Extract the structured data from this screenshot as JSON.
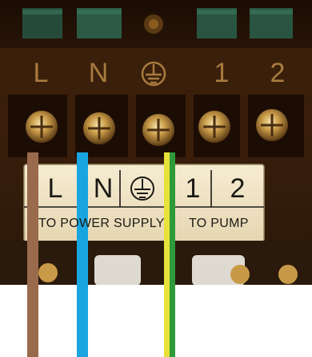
{
  "photo": {
    "description_free": true,
    "colors": {
      "housing_dark": "#2a1608",
      "housing_mid": "#4a2a12",
      "label_plate": "#f2e6c8",
      "screw_brass": "#c89a48",
      "wire_brown": "#9a6a4c",
      "wire_blue": "#19a6e0",
      "wire_earth_yellow": "#e7e13a",
      "wire_earth_green": "#2f9a3a"
    },
    "molded_marks": [
      "L",
      "N",
      "1",
      "2"
    ],
    "plate_marks": [
      "L",
      "N",
      "1",
      "2"
    ],
    "plate_captions": {
      "left": "TO POWER SUPPLY",
      "right": "TO PUMP"
    },
    "icons": [
      "earth-ground-icon"
    ]
  }
}
